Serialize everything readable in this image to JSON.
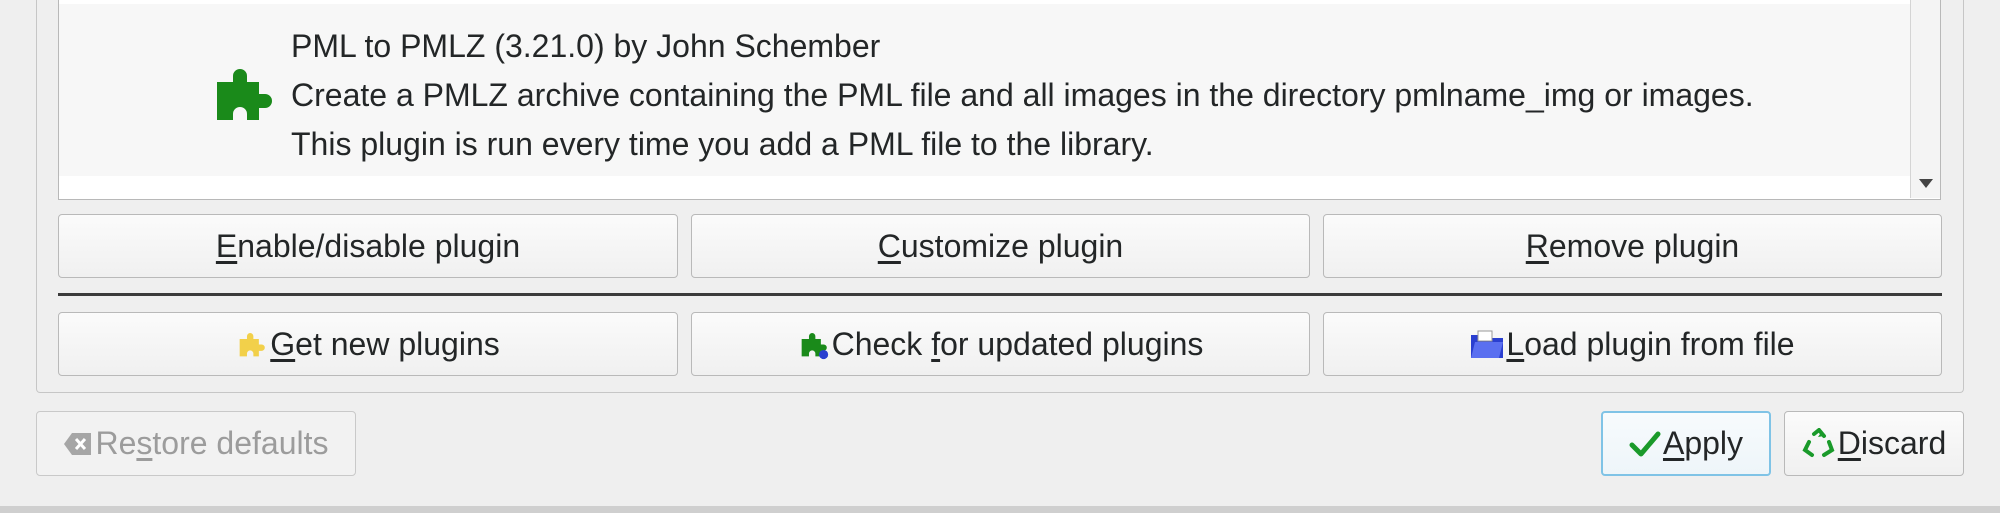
{
  "plugin_list": {
    "entry": {
      "title": "PML to PMLZ (3.21.0) by John Schember",
      "description_line1": "Create a PMLZ archive containing the PML file and all images in the directory pmlname_img or images.",
      "description_line2": "This plugin is run every time you add a PML file to the library.",
      "icon": "puzzle-piece-icon"
    }
  },
  "actions_row1": {
    "enable_disable": {
      "prefix": "",
      "mnemonic": "E",
      "rest": "nable/disable plugin"
    },
    "customize": {
      "prefix": "",
      "mnemonic": "C",
      "rest": "ustomize plugin"
    },
    "remove": {
      "prefix": "",
      "mnemonic": "R",
      "rest": "emove plugin"
    }
  },
  "actions_row2": {
    "get_new": {
      "prefix": "",
      "mnemonic": "G",
      "rest": "et new plugins",
      "icon": "yellow-puzzle-icon"
    },
    "check_updates": {
      "prefix": "Check ",
      "mnemonic": "f",
      "rest": "or updated plugins",
      "icon": "green-puzzle-icon"
    },
    "load_file": {
      "prefix": "",
      "mnemonic": "L",
      "rest": "oad plugin from file",
      "icon": "folder-icon"
    }
  },
  "dialog_buttons": {
    "restore_defaults": {
      "prefix": "Re",
      "mnemonic": "s",
      "rest": "tore defaults",
      "enabled": false,
      "icon": "clear-icon"
    },
    "apply": {
      "prefix": "",
      "mnemonic": "A",
      "rest": "pply",
      "icon": "check-icon"
    },
    "discard": {
      "prefix": "",
      "mnemonic": "D",
      "rest": "iscard",
      "icon": "recycle-icon"
    }
  },
  "colors": {
    "accent_focus": "#7fc3e6",
    "plugin_green": "#1a8a1a",
    "plugin_yellow": "#f2d04a",
    "folder_blue": "#2a3fd0"
  }
}
